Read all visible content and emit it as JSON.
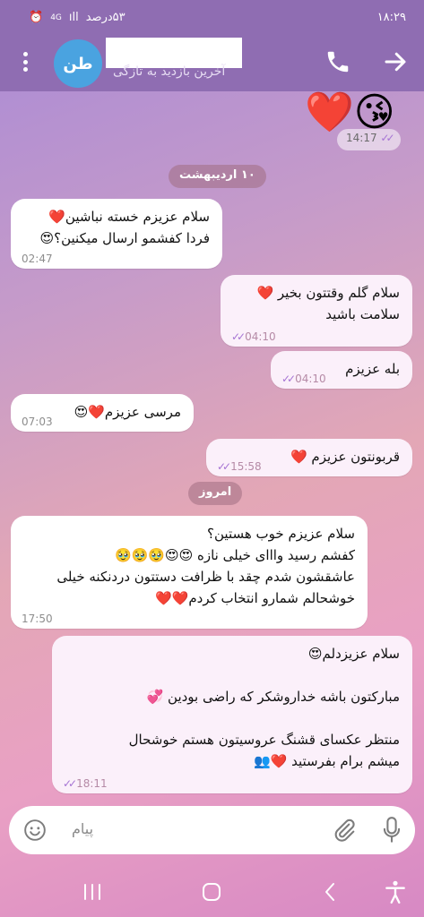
{
  "status_bar": {
    "time": "۱۸:۲۹",
    "battery": "۵۳درصد",
    "network": "4G"
  },
  "header": {
    "avatar_initials": "طن",
    "last_seen": "آخرین بازدید به تازگی"
  },
  "sticker": {
    "emoji": "❤️😘",
    "time": "14:17"
  },
  "dates": {
    "day1": "۱۰ اردیبهشت",
    "today": "امروز"
  },
  "messages": [
    {
      "dir": "in",
      "text": "سلام عزیزم خسته نباشین❤️\nفردا کفشمو ارسال میکنین؟😍",
      "time": "02:47"
    },
    {
      "dir": "out",
      "text": "سلام گلم وقتتون بخیر ❤️\nسلامت باشید",
      "time": "04:10"
    },
    {
      "dir": "out",
      "text": "بله عزیزم",
      "time": "04:10"
    },
    {
      "dir": "in",
      "text": "مرسی عزیزم❤️😍",
      "time": "07:03"
    },
    {
      "dir": "out",
      "text": "قربونتون عزیزم ❤️",
      "time": "15:58"
    },
    {
      "dir": "in",
      "text": "سلام عزیزم خوب هستین؟\nکفشم رسید وااای خیلی نازه 😍😍🥹🥹🥹\nعاشقشون شدم چقد با ظرافت دستتون دردنکنه خیلی\nخوشحالم شمارو انتخاب کردم❤️❤️",
      "time": "17:50"
    },
    {
      "dir": "out",
      "text": "سلام عزیزدلم😍\n\nمبارکتون باشه خداروشکر که راضی بودین 💞\n\nمنتظر عکسای قشنگ عروسیتون هستم خوشحال\nمیشم برام بفرستید ❤️👥",
      "time": "18:11"
    }
  ],
  "input": {
    "placeholder": "پیام"
  },
  "icons": {
    "menu": "more-vert-icon",
    "call": "phone-icon",
    "forward": "forward-arrow-icon",
    "emoji": "smiley-icon",
    "attach": "paperclip-icon",
    "mic": "microphone-icon"
  },
  "colors": {
    "header": "#8f6db2",
    "avatar": "#4aa3e0",
    "incoming": "#ffffff",
    "outgoing": "#fbf0fa",
    "read_ticks": "#a674d4"
  }
}
